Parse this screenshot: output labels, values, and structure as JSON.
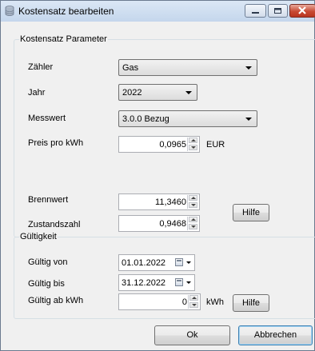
{
  "window": {
    "title": "Kostensatz bearbeiten",
    "icon": "database-icon"
  },
  "params": {
    "group_label": "Kostensatz Parameter",
    "zaehler_label": "Zähler",
    "zaehler_value": "Gas",
    "jahr_label": "Jahr",
    "jahr_value": "2022",
    "messwert_label": "Messwert",
    "messwert_value": "3.0.0 Bezug",
    "preis_label": "Preis pro kWh",
    "preis_value": "0,0965",
    "preis_unit": "EUR",
    "brennwert_label": "Brennwert",
    "brennwert_value": "11,3460",
    "zustandszahl_label": "Zustandszahl",
    "zustandszahl_value": "0,9468",
    "hilfe_label": "Hilfe"
  },
  "validity": {
    "group_label": "Gültigkeit",
    "von_label": "Gültig von",
    "von_value": "01.01.2022",
    "bis_label": "Gültig bis",
    "bis_value": "31.12.2022",
    "kwh_label": "Gültig ab kWh",
    "kwh_value": "0",
    "kwh_unit": "kWh",
    "hilfe_label": "Hilfe"
  },
  "footer": {
    "ok_label": "Ok",
    "cancel_label": "Abbrechen"
  }
}
